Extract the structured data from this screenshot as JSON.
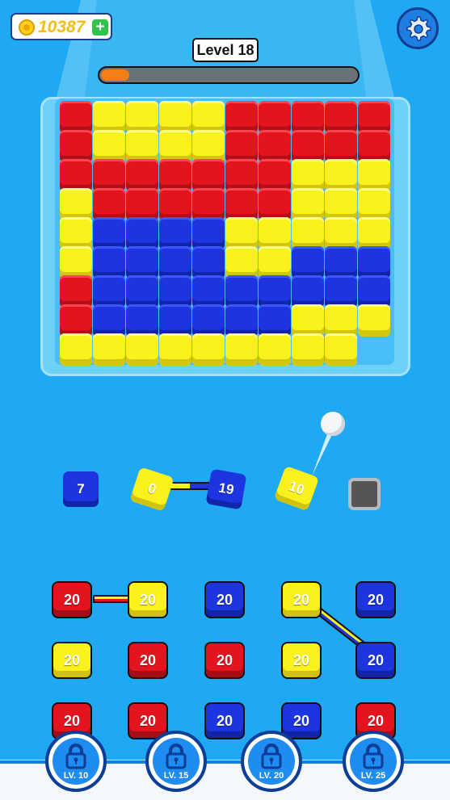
{
  "hud": {
    "coins": "10387",
    "coin_add_symbol": "+",
    "level_label": "Level 18",
    "progress": 0.11
  },
  "colors": {
    "red": "#e4141f",
    "yellow": "#fbf21d",
    "blue": "#1c35e0",
    "background": "#1fa9f2",
    "progress": "#f07f16"
  },
  "board_rows": [
    "RYYYYRRRRR",
    "RYYYYRRRRR",
    "RRRRRRRYYY",
    "YRRRRRRYYY",
    "YBBBBYYYYY",
    "YBBBBYYBBB",
    "RBBBBBBBBB",
    "RBBBBBBYYY",
    "YYYYYYYYY."
  ],
  "shooters": [
    {
      "color": "blue",
      "value": "7"
    },
    {
      "color": "yellow",
      "value": "0"
    },
    {
      "color": "blue",
      "value": "19"
    },
    {
      "color": "yellow",
      "value": "10"
    }
  ],
  "queue": [
    [
      {
        "color": "red",
        "value": "20"
      },
      {
        "color": "yellow",
        "value": "20"
      },
      {
        "color": "blue",
        "value": "20"
      },
      {
        "color": "yellow",
        "value": "20"
      },
      {
        "color": "blue",
        "value": "20"
      }
    ],
    [
      {
        "color": "yellow",
        "value": "20"
      },
      {
        "color": "red",
        "value": "20"
      },
      {
        "color": "red",
        "value": "20"
      },
      {
        "color": "yellow",
        "value": "20"
      },
      {
        "color": "blue",
        "value": "20"
      }
    ],
    [
      {
        "color": "red",
        "value": "20"
      },
      {
        "color": "red",
        "value": "20"
      },
      {
        "color": "blue",
        "value": "20"
      },
      {
        "color": "blue",
        "value": "20"
      },
      {
        "color": "red",
        "value": "20"
      }
    ]
  ],
  "locks": [
    {
      "label": "LV. 10",
      "icon": "lock-icon"
    },
    {
      "label": "LV. 15",
      "icon": "lock-icon"
    },
    {
      "label": "LV. 20",
      "icon": "lock-icon"
    },
    {
      "label": "LV. 25",
      "icon": "lock-icon"
    }
  ]
}
